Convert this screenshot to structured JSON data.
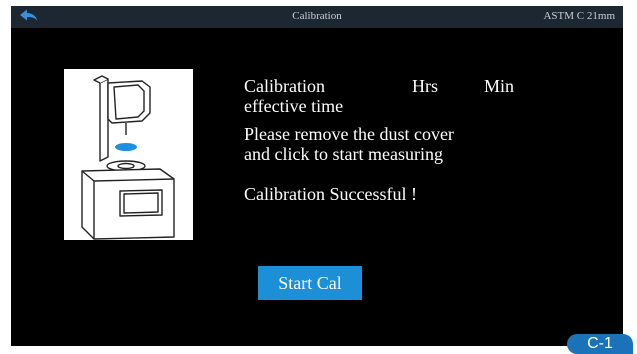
{
  "titlebar": {
    "back_icon": "back-arrow-icon",
    "title": "Calibration",
    "standard": "ASTM C 21mm"
  },
  "calibration": {
    "label": "Calibration",
    "hrs_label": "Hrs",
    "min_label": "Min",
    "effective_time_label": "effective time",
    "instruction_line1": "Please remove the dust cover",
    "instruction_line2": "and click to start measuring",
    "status": "Calibration Successful !"
  },
  "start_button": {
    "label": "Start Cal"
  },
  "badge": {
    "label": "C-1"
  },
  "colors": {
    "screen_bg": "#000000",
    "titlebar_bg": "#1c2731",
    "accent_blue": "#1d8fd6",
    "badge_blue": "#1a73b9",
    "back_icon": "#3b8fd8"
  }
}
